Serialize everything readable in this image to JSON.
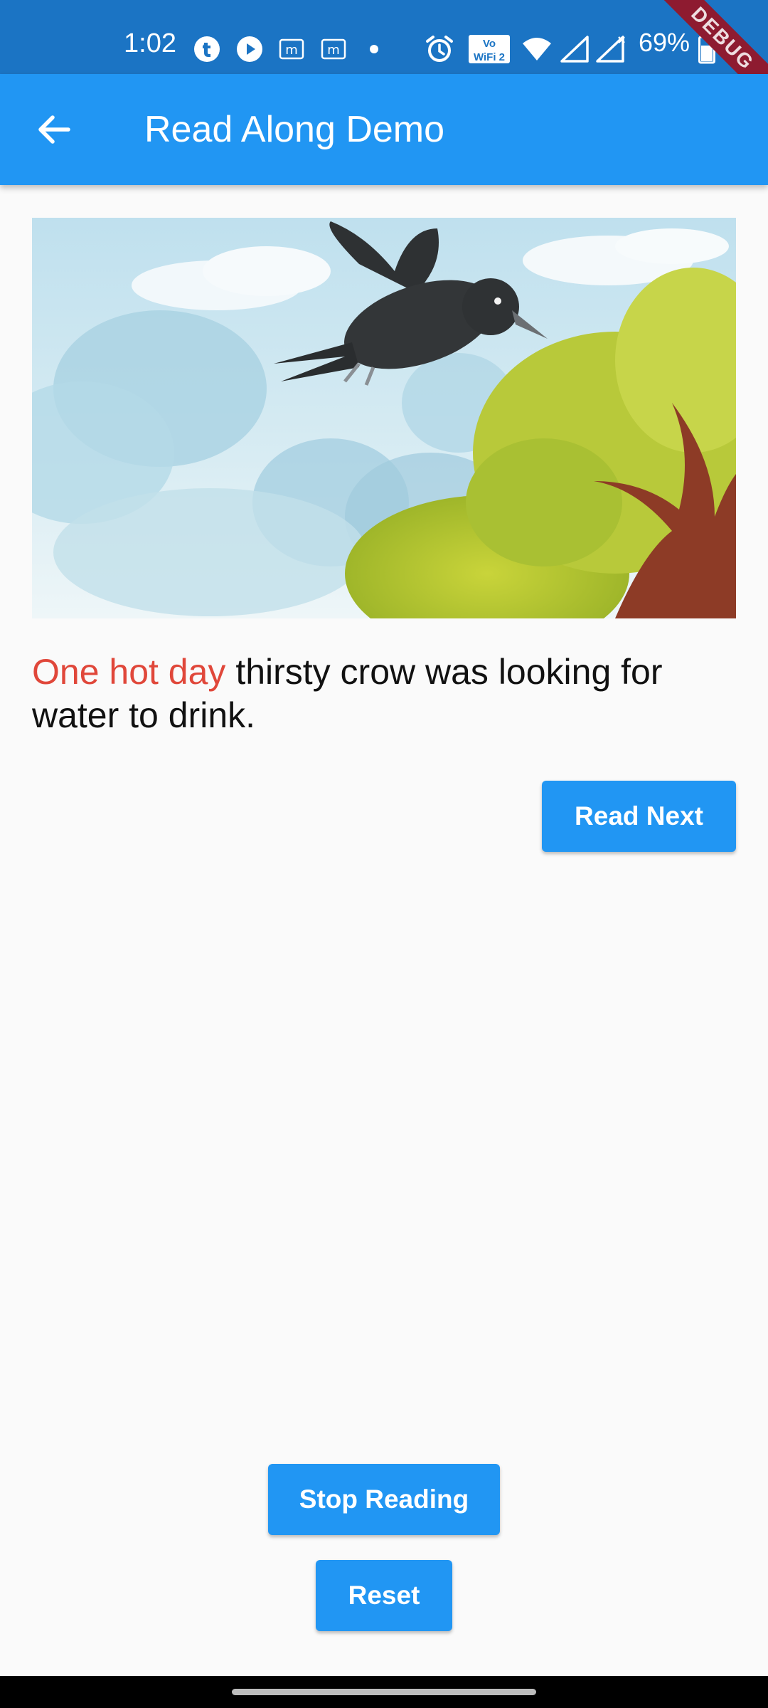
{
  "status_bar": {
    "time": "1:02",
    "battery_percent": "69%",
    "icons": [
      "tumblr-icon",
      "play-icon",
      "m-notification-icon",
      "m-notification-icon",
      "dot-icon",
      "alarm-icon",
      "vowifi-icon",
      "wifi-icon",
      "signal-icon",
      "signal-x-icon",
      "battery-icon"
    ],
    "vowifi_label_top": "Vo",
    "vowifi_label_bottom": "WiFi 2"
  },
  "debug_banner": "DEBUG",
  "app_bar": {
    "title": "Read Along Demo",
    "back_icon": "arrow-back-icon",
    "background": "#2196f3"
  },
  "story": {
    "image_icon": "crow-illustration",
    "text_highlighted": "One hot day",
    "text_rest": " thirsty crow was looking for water to drink.",
    "highlight_color": "#e0473a"
  },
  "buttons": {
    "read_next": "Read Next",
    "stop_reading": "Stop Reading",
    "reset": "Reset"
  },
  "colors": {
    "accent": "#2196f3",
    "status_bar": "#1b74c4"
  }
}
